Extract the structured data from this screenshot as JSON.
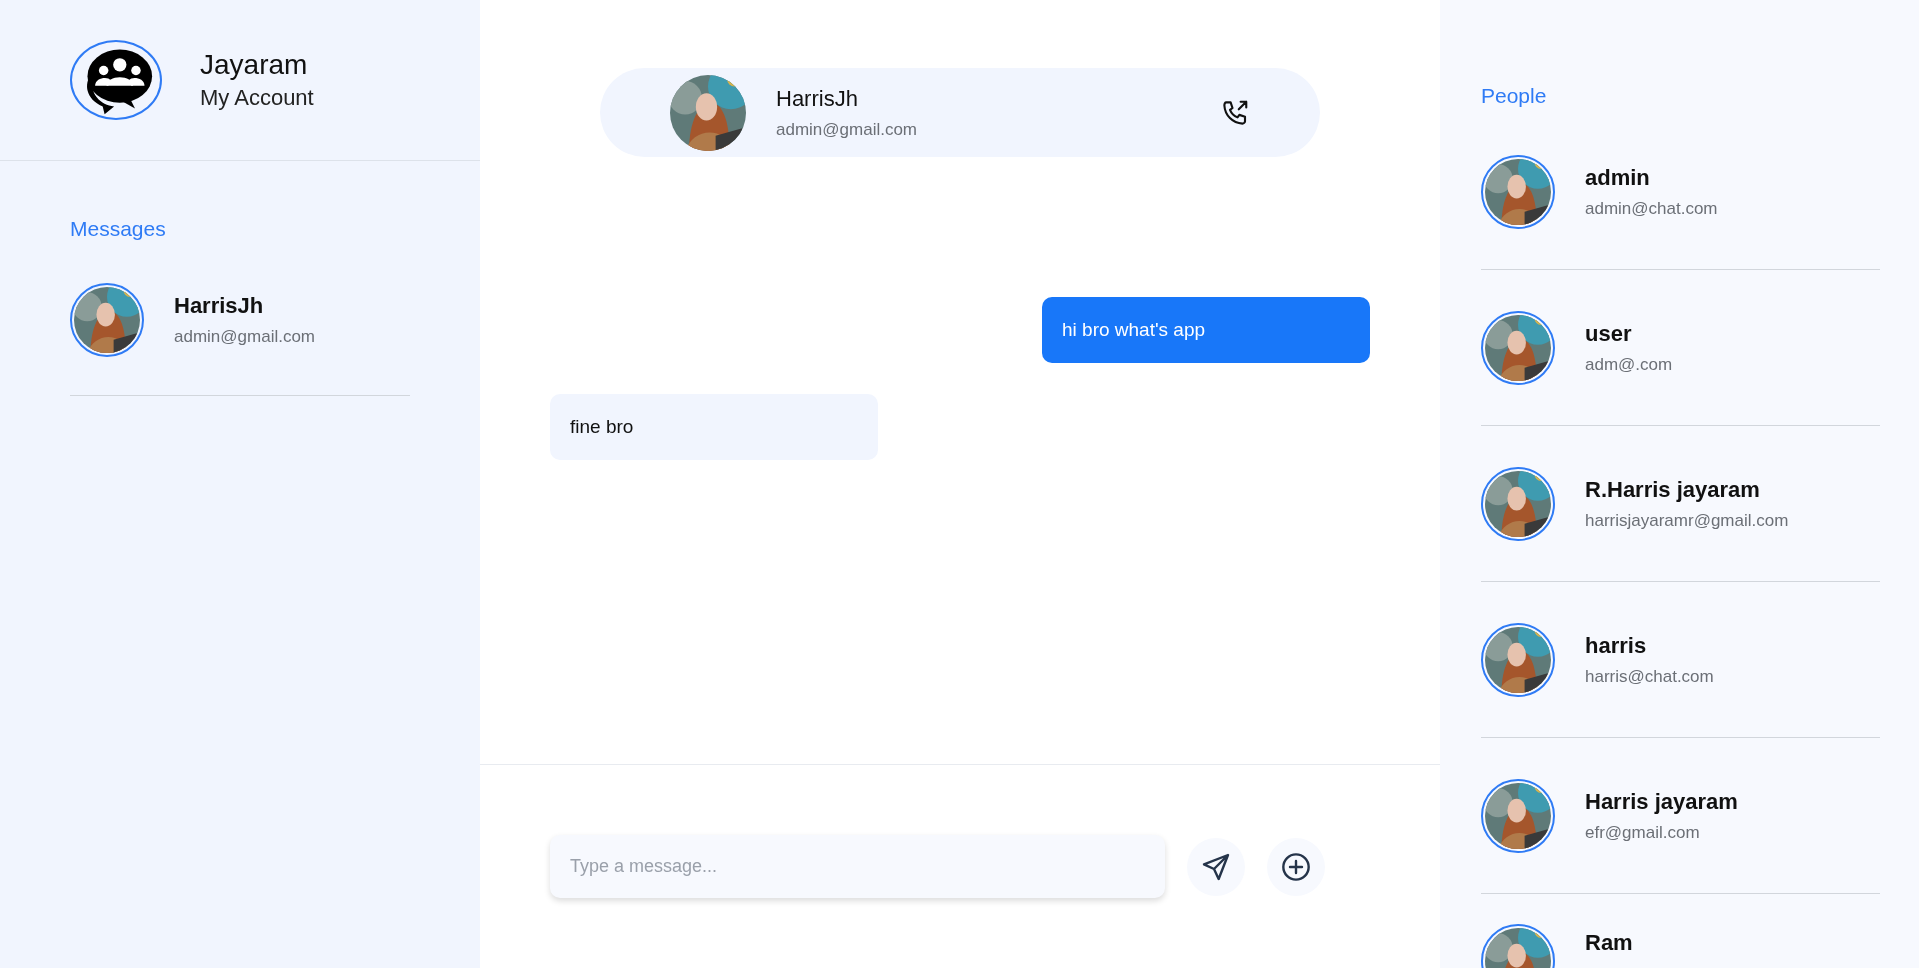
{
  "account": {
    "name": "Jayaram",
    "subtitle": "My Account"
  },
  "messages_panel": {
    "title": "Messages",
    "conversations": [
      {
        "name": "HarrisJh",
        "email": "admin@gmail.com"
      }
    ]
  },
  "chat": {
    "contact": {
      "name": "HarrisJh",
      "email": "admin@gmail.com"
    },
    "messages": [
      {
        "text": "hi bro what's app",
        "kind": "sent"
      },
      {
        "text": "fine bro",
        "kind": "received"
      }
    ],
    "composer": {
      "placeholder": "Type a message..."
    }
  },
  "people": {
    "title": "People",
    "contacts": [
      {
        "name": "admin",
        "email": "admin@chat.com"
      },
      {
        "name": "user",
        "email": "adm@.com"
      },
      {
        "name": "R.Harris jayaram",
        "email": "harrisjayaramr@gmail.com"
      },
      {
        "name": "harris",
        "email": "harris@chat.com"
      },
      {
        "name": "Harris jayaram",
        "email": "efr@gmail.com"
      },
      {
        "name": "Ram"
      }
    ]
  }
}
